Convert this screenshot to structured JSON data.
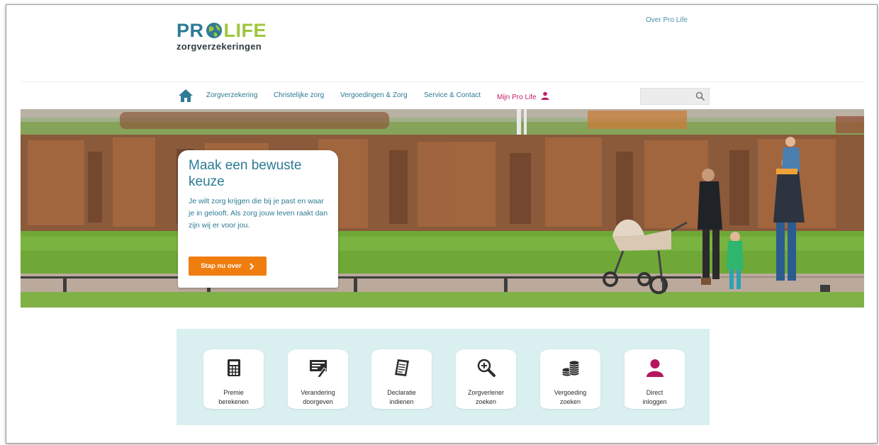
{
  "header": {
    "top_link": "Over Pro Life",
    "logo": {
      "word1": "PR",
      "word2": "LIFE",
      "subtitle": "zorgverzekeringen"
    }
  },
  "nav": {
    "items": [
      "Zorgverzekering",
      "Christelijke zorg",
      "Vergoedingen & Zorg",
      "Service & Contact"
    ],
    "my_account": "Mijn Pro Life",
    "search_placeholder": ""
  },
  "hero": {
    "title": "Maak een bewuste keuze",
    "text": "Je wilt zorg krijgen die bij je past en waar je in gelooft. Als zorg jouw leven raakt dan zijn wij er voor jou.",
    "cta_label": "Stap nu over"
  },
  "quick_links": [
    {
      "label": "Premie\nberekenen",
      "icon": "calculator-icon"
    },
    {
      "label": "Verandering\ndoorgeven",
      "icon": "edit-form-icon"
    },
    {
      "label": "Declaratie\nindienen",
      "icon": "document-icon"
    },
    {
      "label": "Zorgverlener\nzoeken",
      "icon": "magnifier-plus-icon"
    },
    {
      "label": "Vergoeding\nzoeken",
      "icon": "coins-icon"
    },
    {
      "label": "Direct\ninloggen",
      "icon": "user-icon"
    }
  ],
  "colors": {
    "brand_blue": "#2e7b95",
    "brand_green": "#9fc63b",
    "accent_pink": "#c0206b",
    "cta_orange": "#f07d0f",
    "panel_bg": "#d9eff0"
  }
}
